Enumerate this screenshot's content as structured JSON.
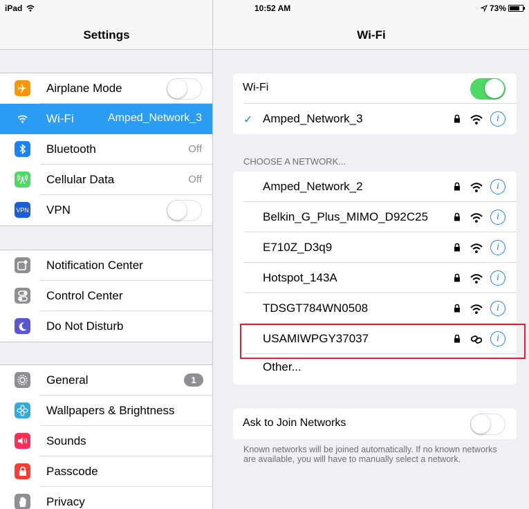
{
  "status": {
    "device": "iPad",
    "time": "10:52 AM",
    "battery": "73%"
  },
  "left": {
    "title": "Settings",
    "groups": [
      [
        {
          "label": "Airplane Mode",
          "icon": "airplane-icon",
          "color": "#ff9500",
          "toggle": "off"
        },
        {
          "label": "Wi-Fi",
          "value": "Amped_Network_3",
          "icon": "wifi-icon",
          "color": "#2a9cf4",
          "selected": true
        },
        {
          "label": "Bluetooth",
          "value": "Off",
          "icon": "bluetooth-icon",
          "color": "#1a82fb"
        },
        {
          "label": "Cellular Data",
          "value": "Off",
          "icon": "cellular-icon",
          "color": "#4cd964"
        },
        {
          "label": "VPN",
          "icon_text": "VPN",
          "icon": "vpn-icon",
          "color": "#1a5fd8",
          "toggle": "off"
        }
      ],
      [
        {
          "label": "Notification Center",
          "icon": "notification-center-icon",
          "color": "#8e8e93"
        },
        {
          "label": "Control Center",
          "icon": "control-center-icon",
          "color": "#8e8e93"
        },
        {
          "label": "Do Not Disturb",
          "icon": "moon-icon",
          "color": "#5856d6"
        }
      ],
      [
        {
          "label": "General",
          "badge": "1",
          "icon": "gear-icon",
          "color": "#8e8e93"
        },
        {
          "label": "Wallpapers & Brightness",
          "icon": "wallpaper-icon",
          "color": "#34aadc"
        },
        {
          "label": "Sounds",
          "icon": "speaker-icon",
          "color": "#ff2d55"
        },
        {
          "label": "Passcode",
          "icon": "lock-icon",
          "color": "#ff3b30"
        },
        {
          "label": "Privacy",
          "icon": "hand-icon",
          "color": "#8e8e93"
        }
      ]
    ]
  },
  "right": {
    "title": "Wi-Fi",
    "wifi_toggle_label": "Wi-Fi",
    "wifi_toggle": "on",
    "connected": "Amped_Network_3",
    "choose_header": "CHOOSE A NETWORK...",
    "networks": [
      {
        "name": "Amped_Network_2",
        "secured": true,
        "signal": "wifi-icon"
      },
      {
        "name": "Belkin_G_Plus_MIMO_D92C25",
        "secured": true,
        "signal": "wifi-icon"
      },
      {
        "name": "E710Z_D3q9",
        "secured": true,
        "signal": "wifi-icon"
      },
      {
        "name": "Hotspot_143A",
        "secured": true,
        "signal": "wifi-icon"
      },
      {
        "name": "TDSGT784WN0508",
        "secured": true,
        "signal": "wifi-icon"
      },
      {
        "name": "USAMIWPGY37037",
        "secured": true,
        "signal": "personal-hotspot-icon",
        "highlighted": true
      }
    ],
    "other_label": "Other...",
    "ask_label": "Ask to Join Networks",
    "ask_toggle": "off",
    "ask_note": "Known networks will be joined automatically. If no known networks are available, you will have to manually select a network.",
    "info_glyph": "i",
    "highlight_color": "#e0202a"
  }
}
